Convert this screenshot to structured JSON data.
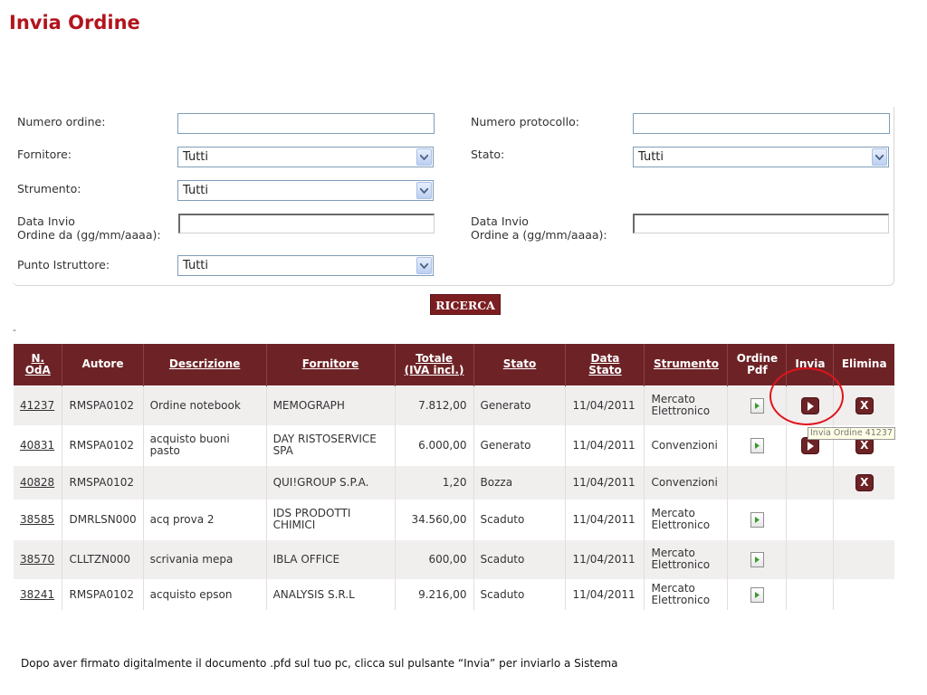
{
  "page_title": "Invia Ordine",
  "form": {
    "numero_ordine_label": "Numero ordine:",
    "numero_ordine_value": "",
    "numero_protocollo_label": "Numero protocollo:",
    "numero_protocollo_value": "",
    "fornitore_label": "Fornitore:",
    "fornitore_value": "Tutti",
    "stato_label": "Stato:",
    "stato_value": "Tutti",
    "strumento_label": "Strumento:",
    "strumento_value": "Tutti",
    "data_da_label_1": "Data Invio",
    "data_da_label_2": "Ordine da (gg/mm/aaaa):",
    "data_da_value": "",
    "data_a_label_1": "Data Invio",
    "data_a_label_2": "Ordine a (gg/mm/aaaa):",
    "data_a_value": "",
    "punto_label": "Punto Istruttore:",
    "punto_value": "Tutti",
    "search_button": "RICERCA"
  },
  "dash_mark": "-",
  "table": {
    "headers": {
      "n_oda_1": "N.",
      "n_oda_2": "OdA",
      "autore": "Autore",
      "descrizione": "Descrizione",
      "fornitore": "Fornitore",
      "totale_1": "Totale",
      "totale_2": "(IVA incl.)",
      "stato": "Stato",
      "data_1": "Data",
      "data_2": "Stato",
      "strumento": "Strumento",
      "ordine_pdf_1": "Ordine",
      "ordine_pdf_2": "Pdf",
      "invia": "Invia",
      "elimina": "Elimina"
    },
    "rows": [
      {
        "n": "41237",
        "autore": "RMSPA0102",
        "descrizione": "Ordine notebook",
        "fornitore": "MEMOGRAPH",
        "totale": "7.812,00",
        "stato": "Generato",
        "data": "11/04/2011",
        "strumento": "Mercato Elettronico"
      },
      {
        "n": "40831",
        "autore": "RMSPA0102",
        "descrizione": "acquisto buoni pasto",
        "fornitore": "DAY RISTOSERVICE SPA",
        "totale": "6.000,00",
        "stato": "Generato",
        "data": "11/04/2011",
        "strumento": "Convenzioni"
      },
      {
        "n": "40828",
        "autore": "RMSPA0102",
        "descrizione": "",
        "fornitore": "QUI!GROUP S.P.A.",
        "totale": "1,20",
        "stato": "Bozza",
        "data": "11/04/2011",
        "strumento": "Convenzioni"
      },
      {
        "n": "38585",
        "autore": "DMRLSN000",
        "descrizione": "acq prova 2",
        "fornitore": "IDS PRODOTTI CHIMICI",
        "totale": "34.560,00",
        "stato": "Scaduto",
        "data": "11/04/2011",
        "strumento": "Mercato Elettronico"
      },
      {
        "n": "38570",
        "autore": "CLLTZN000",
        "descrizione": "scrivania mepa",
        "fornitore": "IBLA OFFICE",
        "totale": "600,00",
        "stato": "Scaduto",
        "data": "11/04/2011",
        "strumento": "Mercato Elettronico"
      },
      {
        "n": "38241",
        "autore": "RMSPA0102",
        "descrizione": "acquisto epson",
        "fornitore": "ANALYSIS S.R.L",
        "totale": "9.216,00",
        "stato": "Scaduto",
        "data": "11/04/2011",
        "strumento": "Mercato Elettronico"
      }
    ],
    "delete_glyph": "X"
  },
  "tooltip": "Invia Ordine 41237",
  "footer_note": "Dopo aver firmato digitalmente il documento .pfd sul tuo pc, clicca sul pulsante “Invia” per inviarlo a Sistema",
  "colors": {
    "title_red": "#b3141c",
    "header_maroon": "#6d2326",
    "highlight_red": "#e0141b"
  },
  "icons": [
    "dropdown-arrow-icon",
    "pdf-document-icon",
    "play-icon",
    "delete-x-icon"
  ]
}
